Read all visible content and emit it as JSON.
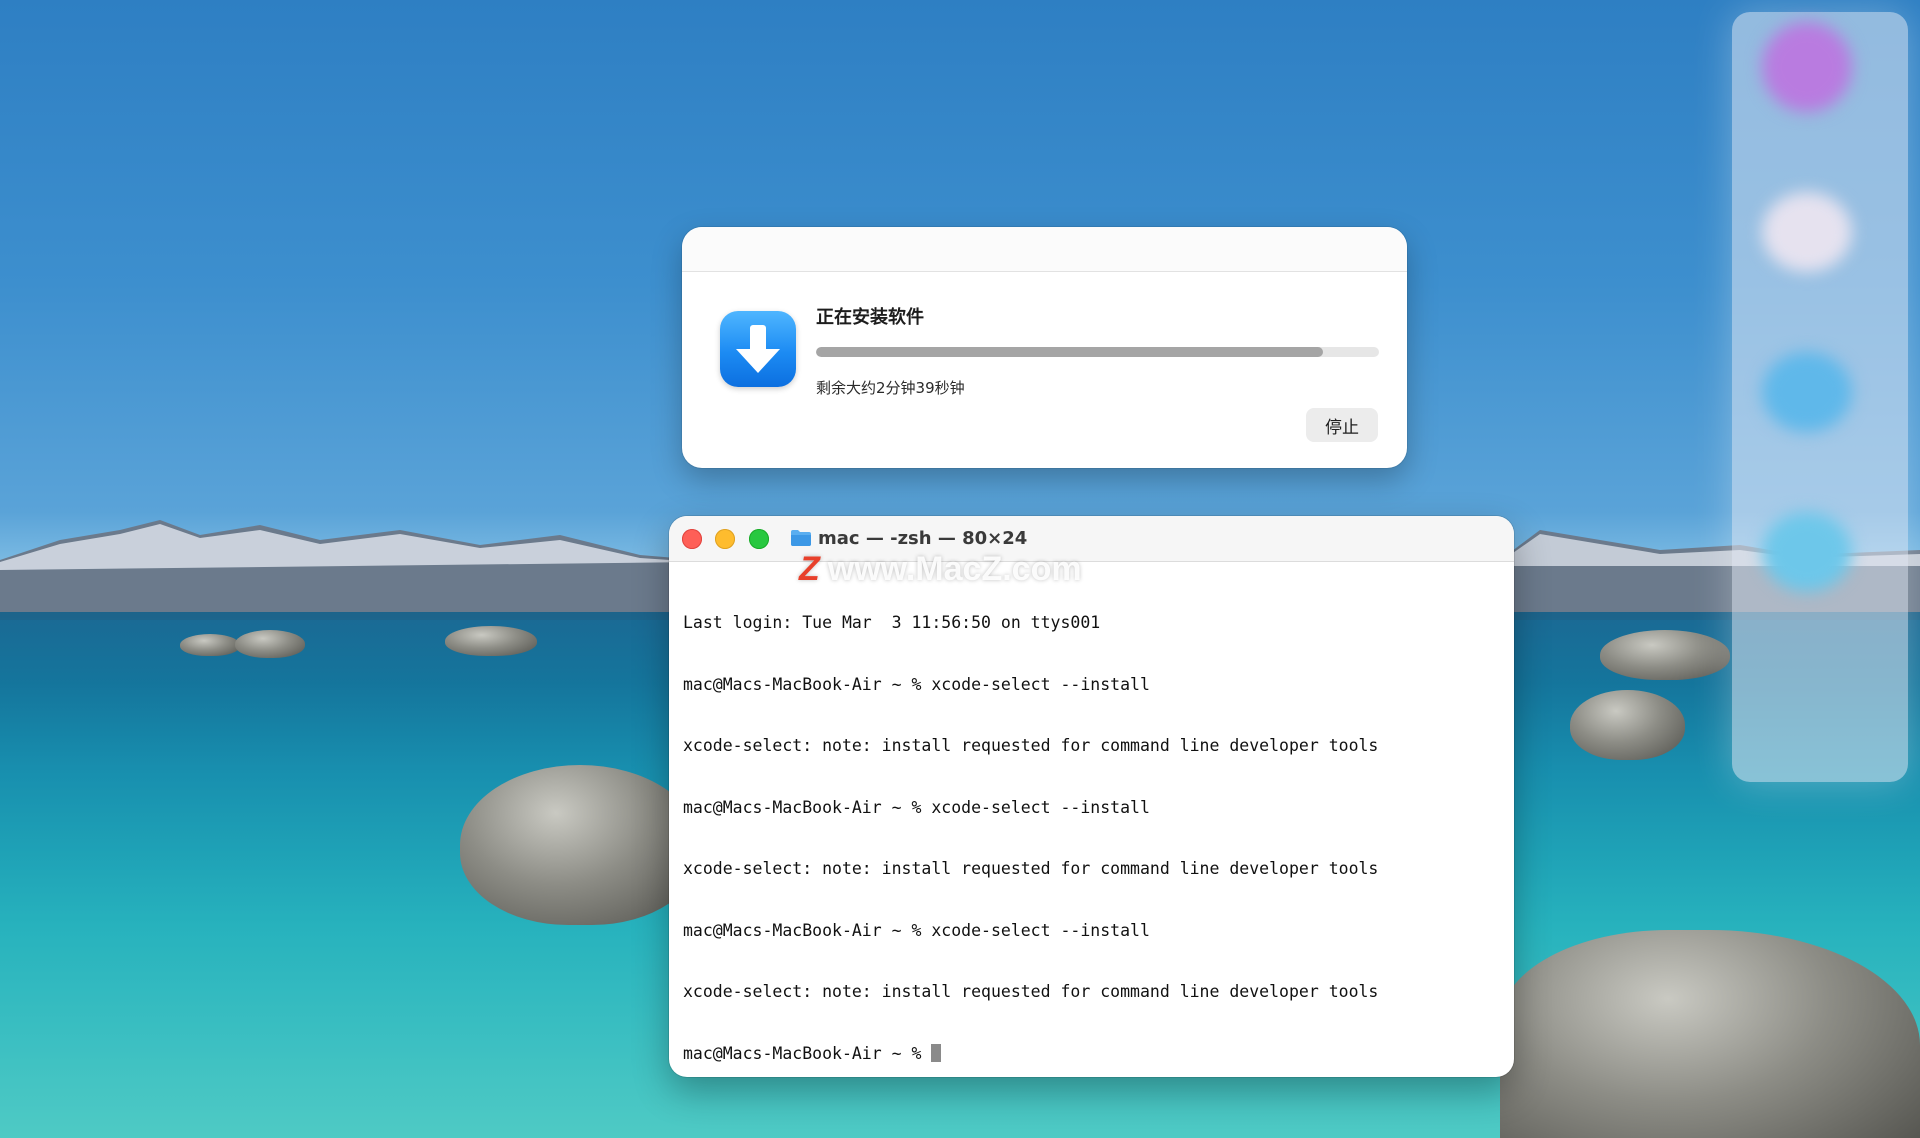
{
  "installer": {
    "title": "正在安装软件",
    "remaining": "剩余大约2分钟39秒钟",
    "progress_percent": 90,
    "stop_label": "停止",
    "icon": "download-arrow-icon"
  },
  "terminal": {
    "title": "mac — -zsh — 80×24",
    "folder_icon": "folder-icon",
    "lines": [
      "Last login: Tue Mar  3 11:56:50 on ttys001",
      "mac@Macs-MacBook-Air ~ % xcode-select --install",
      "xcode-select: note: install requested for command line developer tools",
      "mac@Macs-MacBook-Air ~ % xcode-select --install",
      "xcode-select: note: install requested for command line developer tools",
      "mac@Macs-MacBook-Air ~ % xcode-select --install",
      "xcode-select: note: install requested for command line developer tools",
      "mac@Macs-MacBook-Air ~ % "
    ]
  },
  "watermark": {
    "logo_letter": "Z",
    "text": "www.MacZ.com"
  },
  "colors": {
    "close": "#fe5f57",
    "minimize": "#febc2e",
    "maximize": "#28c840",
    "installer_icon": "#1c8bf3"
  }
}
